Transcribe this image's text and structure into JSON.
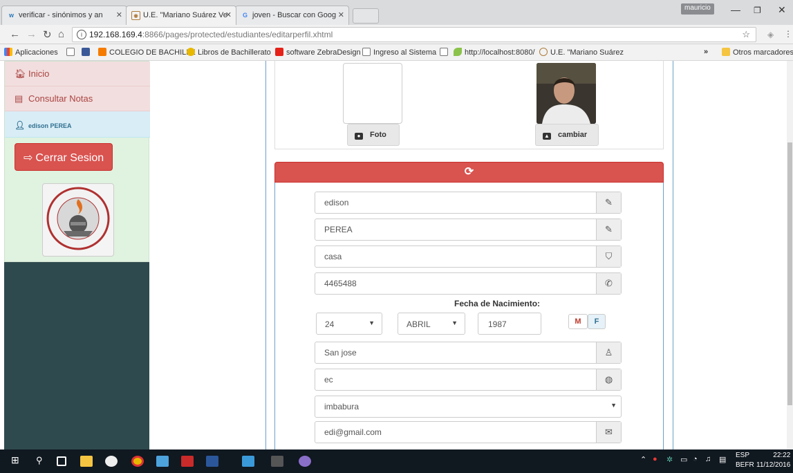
{
  "browser": {
    "tabs": [
      {
        "title": "verificar - sinónimos y an",
        "icon": "wr-icon"
      },
      {
        "title": "U.E. \"Mariano Suárez Ve",
        "icon": "school-icon"
      },
      {
        "title": "joven - Buscar con Goog",
        "icon": "google-icon"
      }
    ],
    "user_badge": "mauricio",
    "url_host": "192.168.169.4",
    "url_path": ":8866/pages/protected/estudiantes/editarperfil.xhtml",
    "bookmarks": [
      "Aplicaciones",
      "",
      "COLEGIO DE BACHILLE",
      "Libros de Bachillerato",
      "software ZebraDesign",
      "Ingreso al Sistema",
      "",
      "http://localhost:8080/",
      "U.E. \"Mariano Suárez",
      "»",
      "Otros marcadores"
    ]
  },
  "sidebar": {
    "items": [
      {
        "label": "Inicio",
        "icon": "home-icon"
      },
      {
        "label": "Consultar Notas",
        "icon": "list-icon"
      }
    ],
    "user": "edison PEREA",
    "logout_label": "Cerrar Sesion",
    "logo_text": "UNIDAD EDUCATIVA MARIANO SUAREZ VEINTIMILLA"
  },
  "photo": {
    "foto_label": "Foto",
    "cambiar_label": "cambiar"
  },
  "form": {
    "nombre": "edison",
    "apellido": "PEREA",
    "direccion": "casa",
    "telefono": "4465488",
    "fecha_label": "Fecha de Nacimiento:",
    "dia": "24",
    "mes": "ABRIL",
    "anio": "1987",
    "sexo_m": "M",
    "sexo_f": "F",
    "ciudad": "San jose",
    "pais": "ec",
    "provincia": "imbabura",
    "email": "edi@gmail.com"
  },
  "taskbar": {
    "lang": "ESP",
    "layout": "BEFR",
    "time": "22:22",
    "date": "11/12/2016"
  },
  "colors": {
    "sidebar_bg": "#2f4a4e",
    "danger": "#d9534f",
    "menu_danger_bg": "#f2dede",
    "menu_info_bg": "#d9edf7"
  }
}
